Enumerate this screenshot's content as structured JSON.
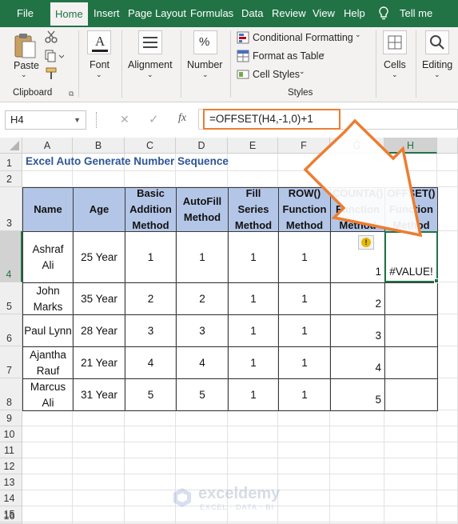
{
  "tabs": [
    "File",
    "Home",
    "Insert",
    "Page Layout",
    "Formulas",
    "Data",
    "Review",
    "View",
    "Help",
    "Tell me"
  ],
  "ribbon": {
    "paste_label": "Paste",
    "clipboard_title": "Clipboard",
    "font_label": "Font",
    "alignment_label": "Alignment",
    "number_label": "Number",
    "cond_format_label": "Conditional Formatting",
    "format_table_label": "Format as Table",
    "cell_styles_label": "Cell Styles",
    "styles_title": "Styles",
    "cells_label": "Cells",
    "editing_label": "Editing"
  },
  "formula_bar": {
    "name_box": "H4",
    "cancel_symbol": "✕",
    "enter_symbol": "✓",
    "fx_symbol": "fx",
    "formula": "=OFFSET(H4,-1,0)+1"
  },
  "sheet": {
    "columns": [
      "A",
      "B",
      "C",
      "D",
      "E",
      "F",
      "G",
      "H"
    ],
    "rows": [
      "1",
      "2",
      "3",
      "4",
      "5",
      "6",
      "7",
      "8",
      "9",
      "10",
      "11",
      "12",
      "13",
      "14",
      "15",
      "16"
    ],
    "title": "Excel Auto Generate Number Sequence",
    "headers": [
      "Name",
      "Age",
      "Basic\nAddition\nMethod",
      "AutoFill\nMethod",
      "Fill\nSeries\nMethod",
      "ROW()\nFunction\nMethod",
      "COUNTA()\nFunction\nMethod",
      "OFFSET()\nFunction\nMethod"
    ],
    "data": [
      [
        "Ashraf\nAli",
        "25 Year",
        "1",
        "1",
        "1",
        "1",
        "1",
        "#VALUE!"
      ],
      [
        "John\nMarks",
        "35 Year",
        "2",
        "2",
        "1",
        "1",
        "2",
        ""
      ],
      [
        "Paul Lynn",
        "28 Year",
        "3",
        "3",
        "1",
        "1",
        "3",
        ""
      ],
      [
        "Ajantha\nRauf",
        "21 Year",
        "4",
        "4",
        "1",
        "1",
        "4",
        ""
      ],
      [
        "Marcus\nAli",
        "31 Year",
        "5",
        "5",
        "1",
        "1",
        "5",
        ""
      ]
    ],
    "error_badge": "!"
  },
  "watermark": {
    "brand": "exceldemy",
    "tagline": "EXCEL · DATA · BI"
  },
  "colors": {
    "excel_green": "#217346",
    "header_fill": "#b4c6e7",
    "title_blue": "#2e5597",
    "arrow_orange": "#ed7d31"
  }
}
